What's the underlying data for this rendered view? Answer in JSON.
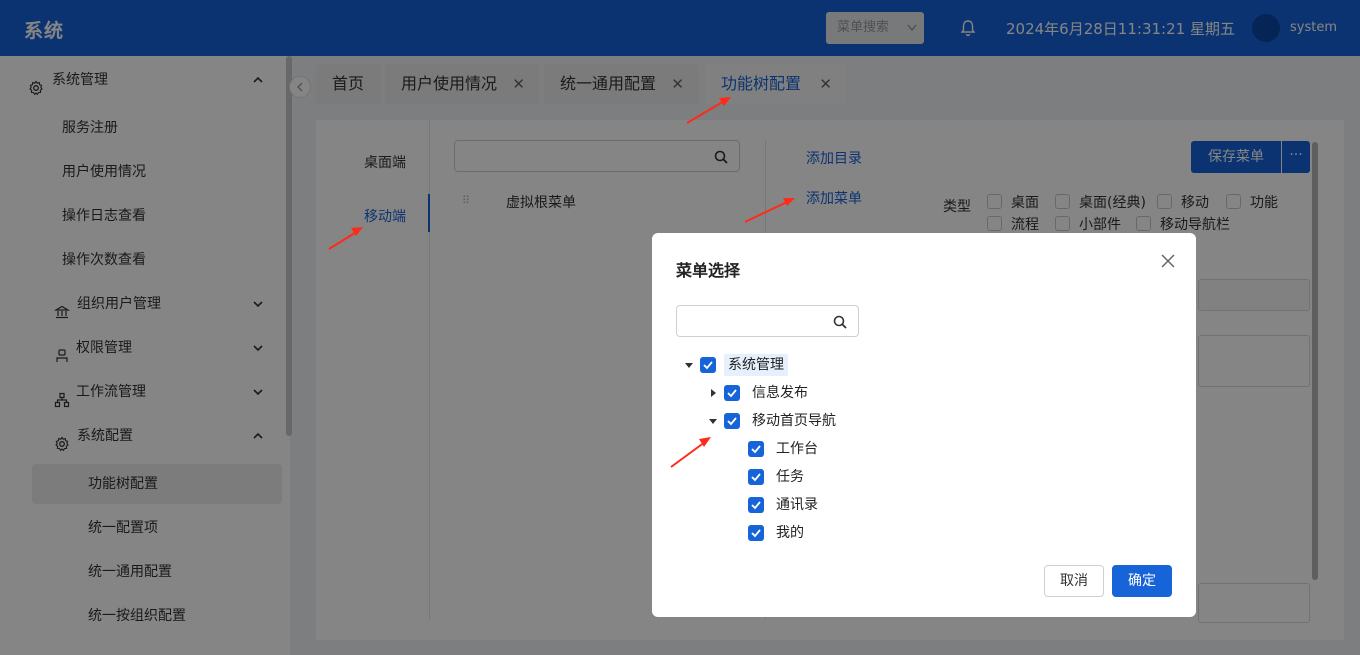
{
  "header": {
    "logo": "系统",
    "menu_search": "菜单搜索",
    "datetime": "2024年6月28日11:31:21 星期五",
    "username": "system"
  },
  "sidebar": {
    "items": [
      {
        "label": "系统管理",
        "icon": "gear-icon",
        "expanded": true
      },
      {
        "label": "服务注册"
      },
      {
        "label": "用户使用情况"
      },
      {
        "label": "操作日志查看"
      },
      {
        "label": "操作次数查看"
      },
      {
        "label": "组织用户管理",
        "icon": "bank-icon"
      },
      {
        "label": "权限管理",
        "icon": "user-icon"
      },
      {
        "label": "工作流管理",
        "icon": "sitemap-icon"
      },
      {
        "label": "系统配置",
        "icon": "gear-icon",
        "expanded": true
      },
      {
        "label": "功能树配置",
        "active": true
      },
      {
        "label": "统一配置项"
      },
      {
        "label": "统一通用配置"
      },
      {
        "label": "统一按组织配置"
      }
    ]
  },
  "tabs": [
    {
      "label": "首页"
    },
    {
      "label": "用户使用情况"
    },
    {
      "label": "统一通用配置"
    },
    {
      "label": "功能树配置",
      "active": true
    }
  ],
  "main": {
    "platforms": [
      "桌面端",
      "移动端"
    ],
    "root_node": "虚拟根菜单",
    "add_directory": "添加目录",
    "add_menu": "添加菜单",
    "save_menu": "保存菜单",
    "more": "···",
    "type_label": "类型",
    "type_options": [
      "桌面",
      "桌面(经典)",
      "移动",
      "功能",
      "流程",
      "小部件",
      "移动导航栏"
    ]
  },
  "modal": {
    "title": "菜单选择",
    "tree": [
      {
        "label": "系统管理",
        "level": 0,
        "expanded": true,
        "checked": true
      },
      {
        "label": "信息发布",
        "level": 1,
        "expanded": false,
        "checked": true
      },
      {
        "label": "移动首页导航",
        "level": 1,
        "expanded": true,
        "checked": true
      },
      {
        "label": "工作台",
        "level": 2,
        "checked": true
      },
      {
        "label": "任务",
        "level": 2,
        "checked": true
      },
      {
        "label": "通讯录",
        "level": 2,
        "checked": true
      },
      {
        "label": "我的",
        "level": 2,
        "checked": true
      }
    ],
    "cancel": "取消",
    "ok": "确定"
  },
  "colors": {
    "primary": "#1763d8",
    "annotation_arrow": "#ff2a1a"
  }
}
